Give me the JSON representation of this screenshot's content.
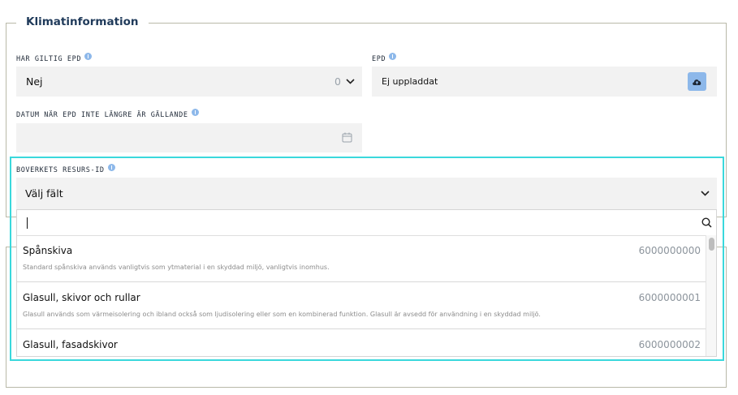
{
  "section": {
    "title": "Klimatinformation"
  },
  "fields": {
    "har_giltig_epd": {
      "label": "HAR GILTIG EPD",
      "value": "Nej",
      "count": "0"
    },
    "epd": {
      "label": "EPD",
      "value": "Ej uppladdat"
    },
    "datum": {
      "label": "DATUM NÄR EPD INTE LÄNGRE ÄR GÄLLANDE",
      "value": ""
    },
    "resurs_id": {
      "label": "BOVERKETS RESURS-ID",
      "placeholder": "Välj fält"
    }
  },
  "dropdown": {
    "search_value": "",
    "items": [
      {
        "title": "Spånskiva",
        "id": "6000000000",
        "desc": "Standard spånskiva används vanligtvis som ytmaterial i en skyddad miljö, vanligtvis inomhus."
      },
      {
        "title": "Glasull, skivor och rullar",
        "id": "6000000001",
        "desc": "Glasull används som värmeisolering och ibland också som ljudisolering eller som en kombinerad funktion. Glasull är avsedd för användning i en skyddad miljö."
      },
      {
        "title": "Glasull, fasadskivor",
        "id": "6000000002",
        "desc": ""
      }
    ]
  },
  "colors": {
    "highlight": "#3ad8dc",
    "info": "#8db8ea",
    "upload_button": "#8db8ea"
  }
}
